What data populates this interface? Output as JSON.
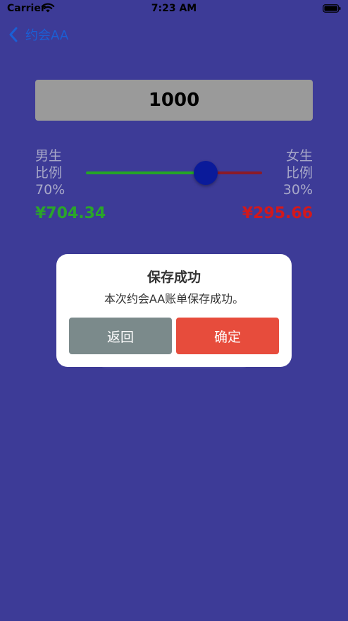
{
  "status_bar": {
    "carrier": "Carrier",
    "time": "7:23 AM"
  },
  "nav": {
    "back_icon": "chevron-left-icon",
    "title": "约会AA"
  },
  "bill": {
    "amount": "1000"
  },
  "ratio": {
    "male_label": "男生",
    "male_sub": "比例",
    "male_percent": "70%",
    "female_label": "女生",
    "female_sub": "比例",
    "female_percent": "30%",
    "slider_value_percent": 70
  },
  "split": {
    "male_amount": "¥704.34",
    "female_amount": "¥295.66"
  },
  "alert": {
    "title": "保存成功",
    "message": "本次约会AA账单保存成功。",
    "cancel_label": "返回",
    "confirm_label": "确定"
  },
  "colors": {
    "background": "#3d3b97",
    "male_green": "#2aa52b",
    "female_red": "#d2181c",
    "confirm_red": "#e74c3c",
    "cancel_gray": "#7b8a8b",
    "slider_thumb": "#0a1a9a"
  }
}
